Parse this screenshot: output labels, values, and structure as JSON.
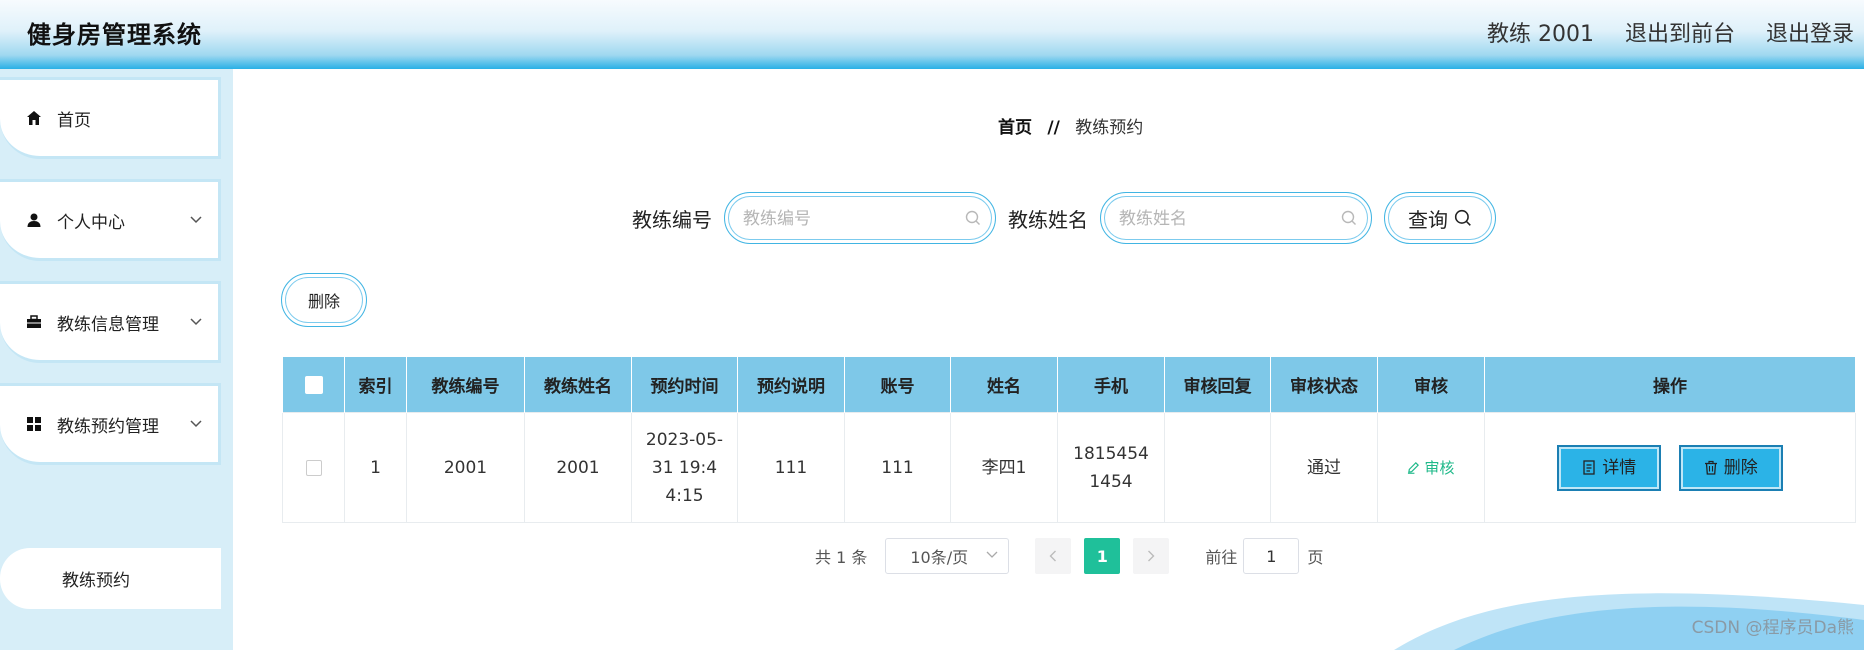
{
  "header": {
    "title": "健身房管理系统",
    "user": "教练 2001",
    "to_front": "退出到前台",
    "logout": "退出登录"
  },
  "sidebar": {
    "items": [
      {
        "label": "首页",
        "icon": "home-icon"
      },
      {
        "label": "个人中心",
        "icon": "user-icon"
      },
      {
        "label": "教练信息管理",
        "icon": "briefcase-icon"
      },
      {
        "label": "教练预约管理",
        "icon": "grid-icon"
      }
    ],
    "sub_item": "教练预约"
  },
  "breadcrumb": {
    "home": "首页",
    "sep": "//",
    "current": "教练预约"
  },
  "search": {
    "coach_no_label": "教练编号",
    "coach_no_placeholder": "教练编号",
    "coach_name_label": "教练姓名",
    "coach_name_placeholder": "教练姓名",
    "query_label": "查询"
  },
  "toolbar": {
    "delete_label": "删除"
  },
  "table": {
    "headers": [
      "",
      "索引",
      "教练编号",
      "教练姓名",
      "预约时间",
      "预约说明",
      "账号",
      "姓名",
      "手机",
      "审核回复",
      "审核状态",
      "审核",
      "操作"
    ],
    "rows": [
      {
        "index": "1",
        "coach_no": "2001",
        "coach_name": "2001",
        "time": "2023-05-31 19:44:15",
        "note": "111",
        "account": "111",
        "name": "李四1",
        "phone": "18154541454",
        "reply": "",
        "status": "通过",
        "audit": "审核",
        "detail": "详情",
        "delete": "删除"
      }
    ]
  },
  "pagination": {
    "total": "共 1 条",
    "page_size": "10条/页",
    "current": "1",
    "goto": "前往",
    "goto_value": "1",
    "page_unit": "页"
  },
  "watermark": "CSDN @程序员Da熊",
  "colors": {
    "header_blue": "#29b0e6",
    "table_header": "#7ec8e8",
    "accent_green": "#1fc09a",
    "button_blue": "#2bb3e7"
  }
}
